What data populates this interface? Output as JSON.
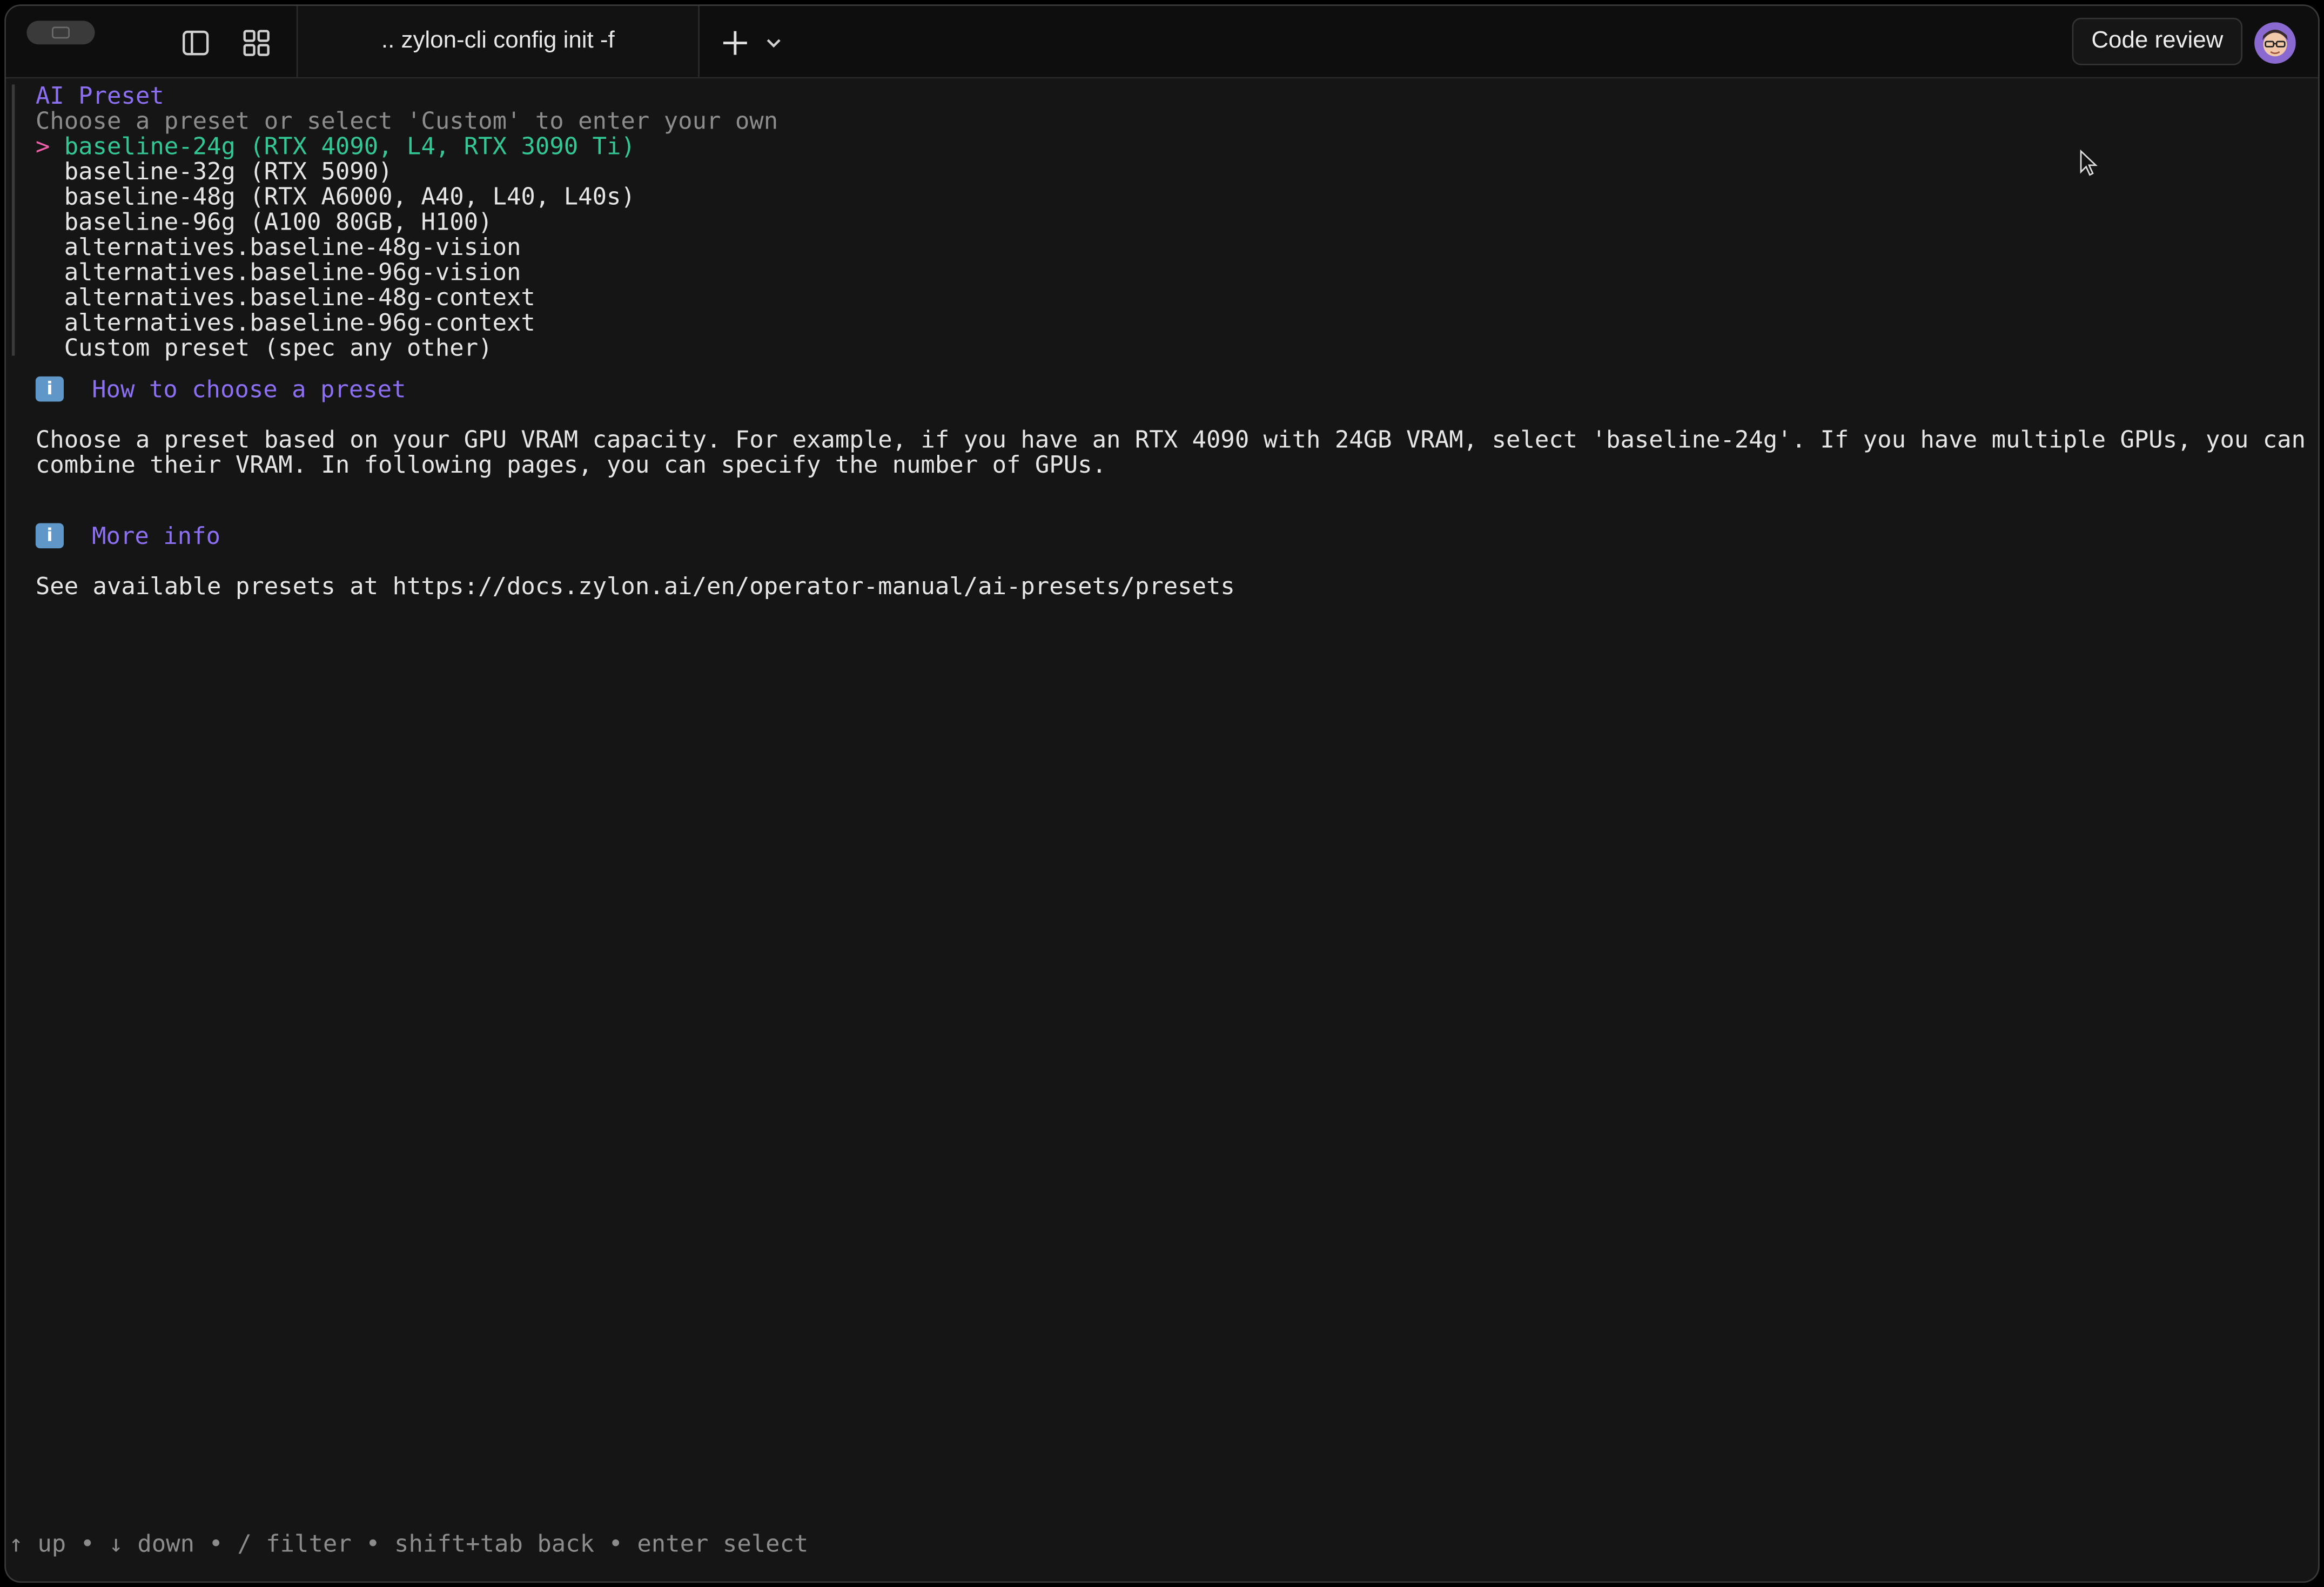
{
  "titlebar": {
    "tab_title": ".. zylon-cli config init -f",
    "code_review_label": "Code review",
    "icons": [
      "sidebar-toggle-icon",
      "grid-icon",
      "plus-icon",
      "chevron-down-icon"
    ]
  },
  "prompt": {
    "title": "AI Preset",
    "description": "Choose a preset or select 'Custom' to enter your own",
    "cursor_marker": ">",
    "options": [
      "baseline-24g (RTX 4090, L4, RTX 3090 Ti)",
      "baseline-32g (RTX 5090)",
      "baseline-48g (RTX A6000, A40, L40, L40s)",
      "baseline-96g (A100 80GB, H100)",
      "alternatives.baseline-48g-vision",
      "alternatives.baseline-96g-vision",
      "alternatives.baseline-48g-context",
      "alternatives.baseline-96g-context",
      "Custom preset (spec any other)"
    ],
    "selected_index": 0
  },
  "notes": [
    {
      "icon": "info-icon",
      "icon_glyph": "i",
      "heading": "How to choose a preset",
      "lines": [
        "Choose a preset based on your GPU VRAM capacity. For example, if you have an RTX 4090 with 24GB VRAM, select 'baseline-24g'. If you have multiple GPUs, you can",
        "combine their VRAM. In following pages, you can specify the number of GPUs."
      ]
    },
    {
      "icon": "info-icon",
      "icon_glyph": "i",
      "heading": "More info",
      "lines": [
        "See available presets at https://docs.zylon.ai/en/operator-manual/ai-presets/presets"
      ]
    }
  ],
  "help_bar": "↑ up • ↓ down • / filter • shift+tab back • enter select",
  "colors": {
    "accent_violet": "#8c6ff2",
    "selected_green": "#34c796",
    "cursor_pink": "#ee5fa8",
    "dim_gray": "#8c8c8c",
    "background": "#151515"
  }
}
